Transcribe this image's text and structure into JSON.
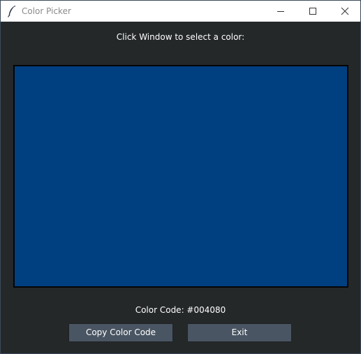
{
  "window": {
    "title": "Color Picker",
    "app_icon": "feather-icon",
    "controls": {
      "minimize_icon": "minimize-icon",
      "maximize_icon": "maximize-icon",
      "close_icon": "close-icon"
    }
  },
  "main": {
    "prompt": "Click Window to select a color:",
    "selected_color": "#004080",
    "color_code_label": "Color Code: #004080"
  },
  "buttons": {
    "copy_label": "Copy Color Code",
    "exit_label": "Exit"
  },
  "colors": {
    "background": "#252829",
    "button": "#4a5563",
    "text": "#ffffff"
  }
}
